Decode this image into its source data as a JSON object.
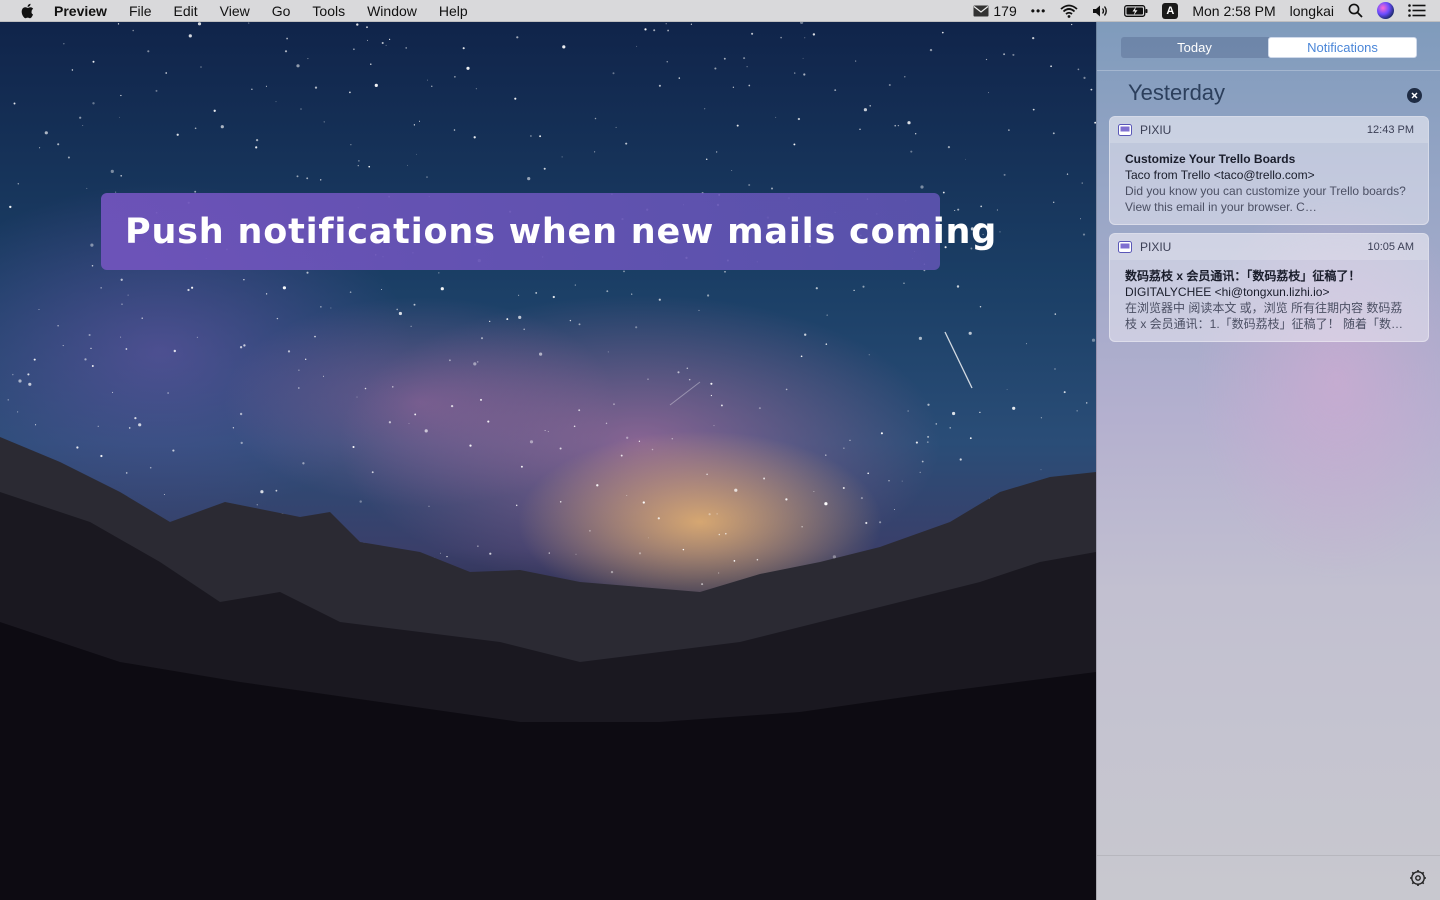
{
  "menubar": {
    "app_name": "Preview",
    "menus": [
      "File",
      "Edit",
      "View",
      "Go",
      "Tools",
      "Window",
      "Help"
    ],
    "mail_count": "179",
    "more": "•••",
    "input_source": "A",
    "clock": "Mon 2:58 PM",
    "user": "longkai",
    "icons": [
      "apple-icon",
      "mail-icon",
      "more-icon",
      "wifi-icon",
      "volume-icon",
      "battery-icon",
      "input-source-icon",
      "search-icon",
      "siri-icon",
      "list-icon"
    ]
  },
  "banner": {
    "text": "Push notifications when new mails coming",
    "color": "#6E56BC"
  },
  "notification_center": {
    "tabs": [
      "Today",
      "Notifications"
    ],
    "selected_tab": "Notifications",
    "section_title": "Yesterday",
    "notifications": [
      {
        "app": "PIXIU",
        "time": "12:43 PM",
        "subject": "Customize Your Trello Boards",
        "from": "Taco from Trello <taco@trello.com>",
        "preview": "Did you know you can customize your Trello boards? View this email in your browser. C…"
      },
      {
        "app": "PIXIU",
        "time": "10:05 AM",
        "subject": "数码荔枝 x 会员通讯：「数码荔枝」征稿了！",
        "from": "DIGITALYCHEE <hi@tongxun.lizhi.io>",
        "preview": "在浏览器中 阅读本文 或，浏览 所有往期内容 数码荔枝 x 会员通讯：1.「数码荔枝」征稿了！ 随着「数…"
      }
    ]
  }
}
